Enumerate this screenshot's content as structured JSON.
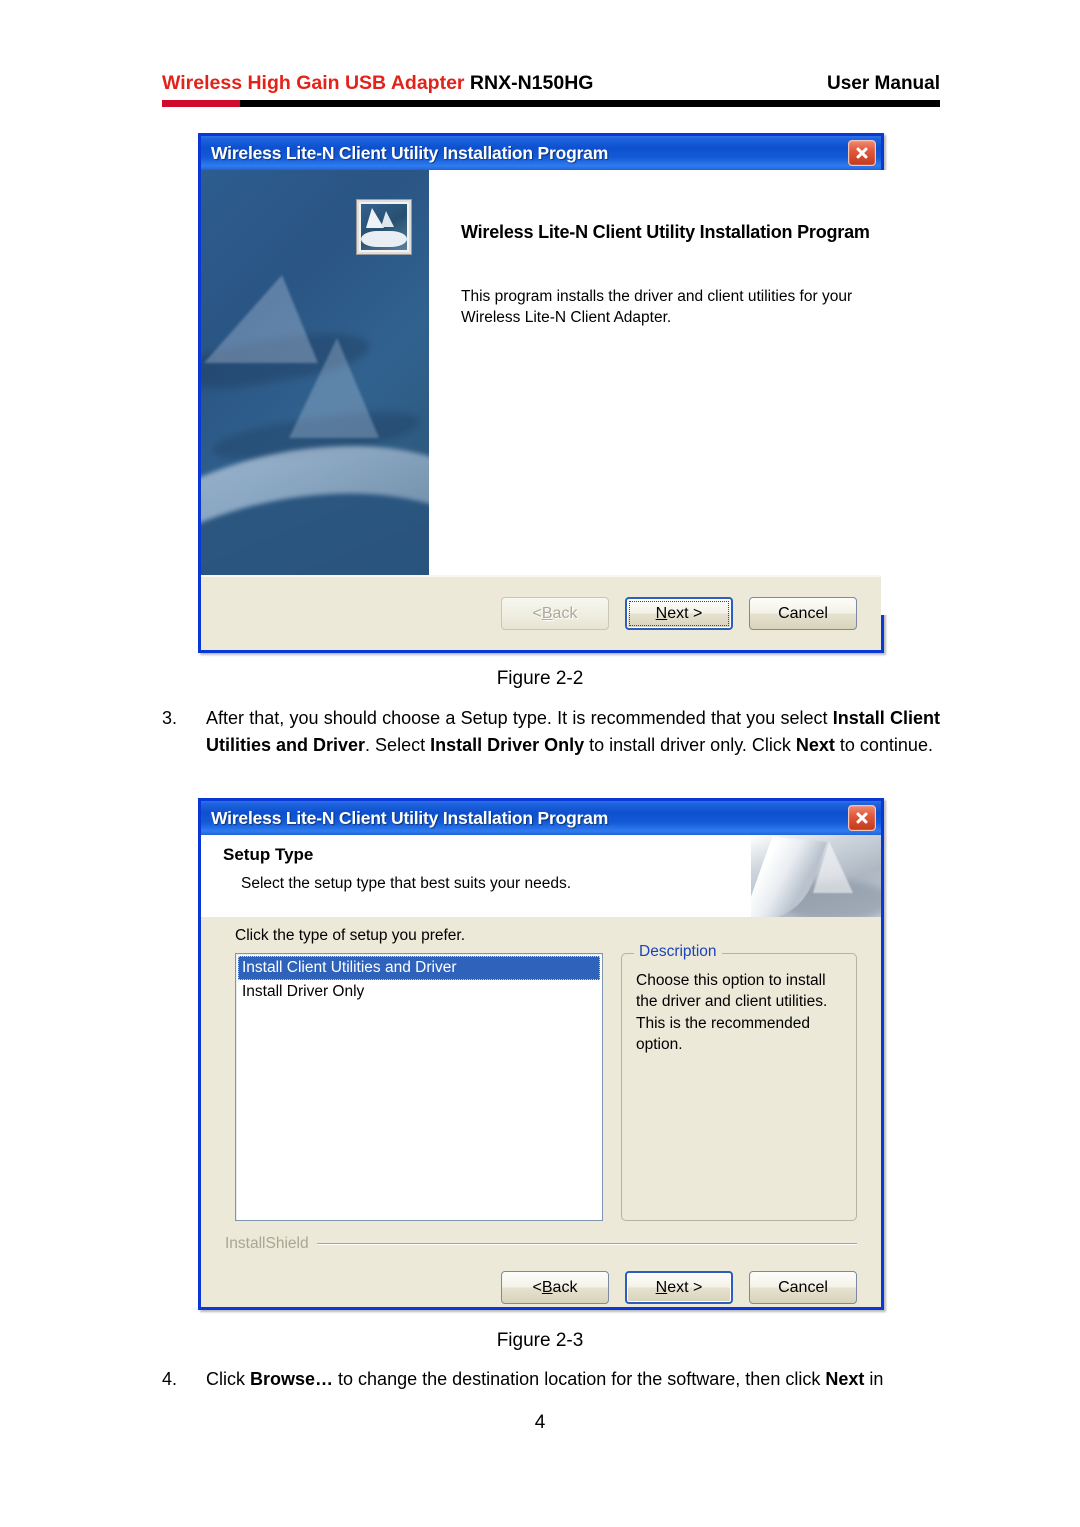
{
  "header": {
    "brand_text": "Wireless High Gain USB Adapter",
    "model_text": " RNX-N150HG",
    "right_text": "User Manual"
  },
  "dialog_welcome": {
    "title": "Wireless Lite-N Client Utility Installation Program",
    "close_icon": "close-icon",
    "app_icon": "sailboat-app-icon",
    "heading": "Wireless Lite-N Client Utility Installation Program",
    "paragraph": "This program installs the driver and client utilities for your Wireless Lite-N Client Adapter.",
    "buttons": {
      "back": "< Back",
      "back_prefix": "< ",
      "back_accel": "B",
      "back_rest": "ack",
      "next_prefix": "",
      "next_accel": "N",
      "next_rest": "ext >",
      "cancel": "Cancel"
    }
  },
  "figure_2_2_caption": "Figure 2-2",
  "step3": {
    "number": "3.",
    "part1": "After that, you should choose a Setup type. It is recommended that you select ",
    "bold1": "Install Client Utilities and Driver",
    "part2": ". Select ",
    "bold2": "Install Driver Only",
    "part3": " to install driver only. Click ",
    "bold3": "Next",
    "part4": " to continue."
  },
  "dialog_setup": {
    "title": "Wireless Lite-N Client Utility Installation Program",
    "close_icon": "close-icon",
    "banner_title": "Setup Type",
    "banner_subtitle": "Select the setup type that best suits your needs.",
    "prompt": "Click the type of setup you prefer.",
    "list_items": [
      {
        "label": "Install Client Utilities and Driver",
        "selected": true
      },
      {
        "label": "Install Driver Only",
        "selected": false
      }
    ],
    "description_title": "Description",
    "description_text": "Choose this option to install the driver and client utilities. This is the recommended option.",
    "installshield_label": "InstallShield",
    "buttons": {
      "back_prefix": "< ",
      "back_accel": "B",
      "back_rest": "ack",
      "next_accel": "N",
      "next_rest": "ext >",
      "cancel": "Cancel"
    }
  },
  "figure_2_3_caption": "Figure 2-3",
  "step4": {
    "number": "4.",
    "part1": "Click ",
    "bold1": "Browse…",
    "part2": " to change the destination location for the software, then click ",
    "bold2": "Next",
    "part3": " in"
  },
  "page_number": "4",
  "colors": {
    "brand_red": "#e2231a",
    "rule_red": "#cf0a2c",
    "titlebar_blue": "#0d50d0",
    "dialog_border": "#0a38d6",
    "dialog_face": "#ece9d8",
    "selection_blue": "#2f62bb",
    "groupbox_title_blue": "#1a44b8",
    "disabled_text": "#aba99a"
  }
}
